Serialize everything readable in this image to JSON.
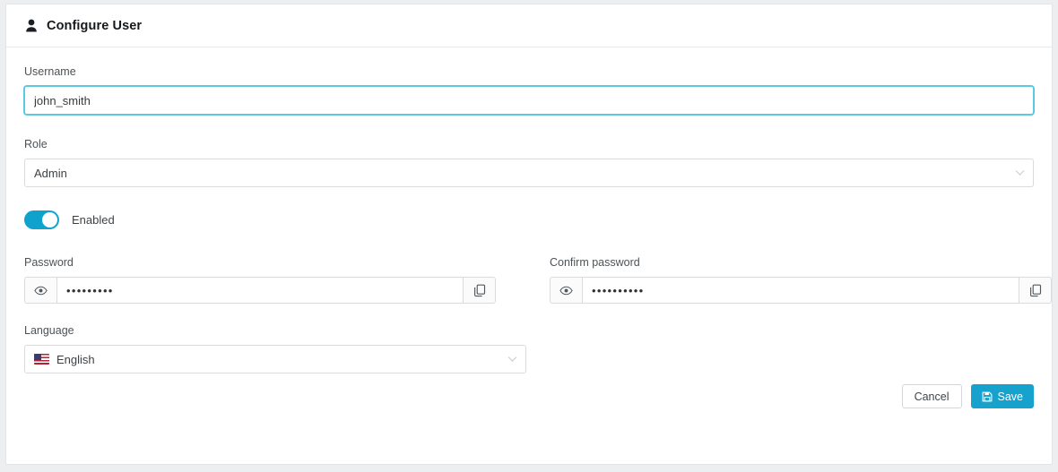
{
  "header": {
    "icon": "user-icon",
    "title": "Configure User"
  },
  "form": {
    "username": {
      "label": "Username",
      "value": "john_smith",
      "placeholder": "",
      "focused": true
    },
    "role": {
      "label": "Role",
      "value": "Admin",
      "chevron_icon": "chevron-down-icon"
    },
    "enabled": {
      "label": "Enabled",
      "state": "on"
    },
    "password": {
      "label": "Password",
      "value": "•••••••••",
      "reveal_icon": "eye-icon",
      "copy_icon": "copy-icon"
    },
    "confirm_password": {
      "label": "Confirm password",
      "value": "••••••••••",
      "reveal_icon": "eye-icon",
      "copy_icon": "copy-icon"
    },
    "language": {
      "label": "Language",
      "value": "English",
      "flag": "us-flag-icon",
      "chevron_icon": "chevron-down-icon"
    }
  },
  "actions": {
    "cancel_label": "Cancel",
    "save_label": "Save",
    "save_icon": "save-disk-icon"
  },
  "colors": {
    "accent": "#16a2cd",
    "toggle_on": "#0fa2cd",
    "focus_border": "#5cc8e2",
    "page_bg": "#eceeef",
    "card_bg": "#ffffff",
    "border": "#d9dcdf",
    "label_text": "#4d5256"
  }
}
